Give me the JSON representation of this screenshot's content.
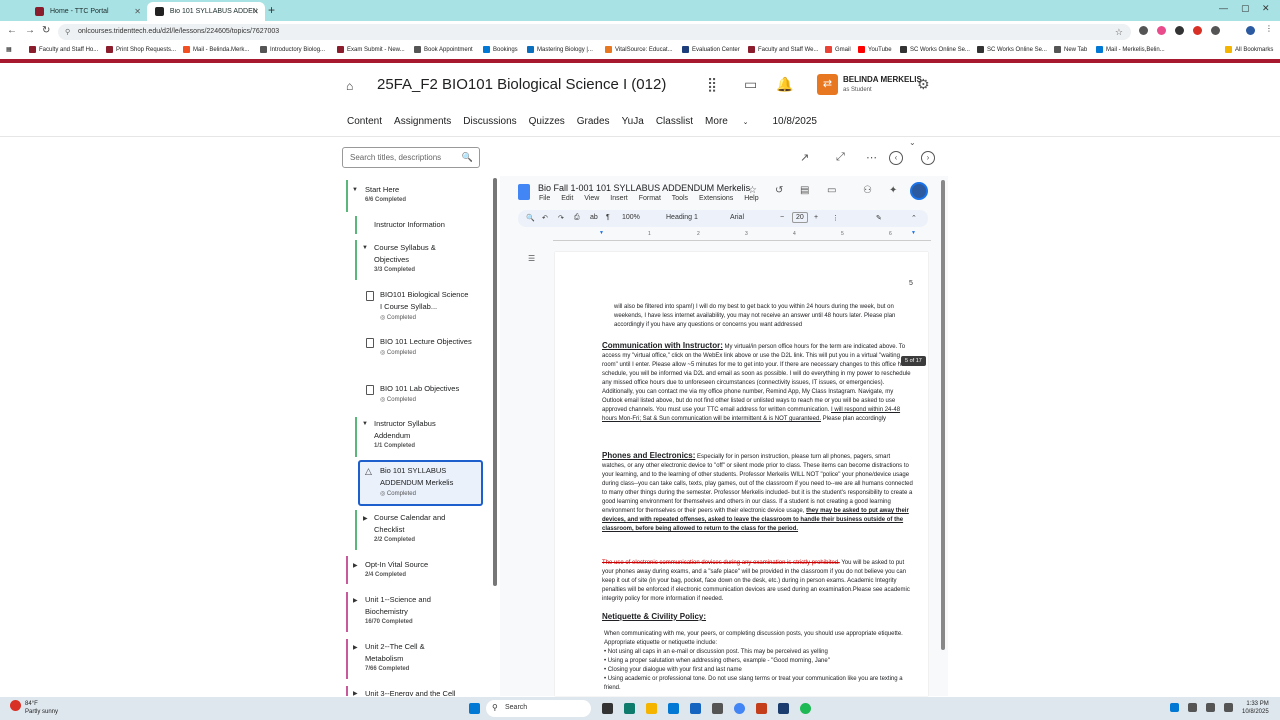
{
  "browser": {
    "tabs": [
      {
        "label": "Home - TTC Portal"
      },
      {
        "label": "Bio 101 SYLLABUS ADDENDUM"
      }
    ],
    "url": "onlcourses.tridenttech.edu/d2l/le/lessons/224605/topics/7627003",
    "bookmarks": [
      "Faculty and Staff Ho...",
      "Print Shop Requests...",
      "Mail - Belinda.Merk...",
      "Introductory Biolog...",
      "Exam Submit - New...",
      "Book Appointment",
      "Bookings",
      "Mastering Biology |...",
      "VitalSource: Educat...",
      "Evaluation Center",
      "Faculty and Staff We...",
      "Gmail",
      "YouTube",
      "SC Works Online Se...",
      "SC Works Online Se...",
      "New Tab",
      "Mail - Merkelis,Belin..."
    ],
    "all_bookmarks": "All Bookmarks"
  },
  "header": {
    "course_title": "25FA_F2 BIO101 Biological Science I (012)",
    "user_name": "BELINDA MERKELIS",
    "user_role": "as Student"
  },
  "nav": [
    "Content",
    "Assignments",
    "Discussions",
    "Quizzes",
    "Grades",
    "YuJa",
    "Classlist",
    "More",
    "10/8/2025"
  ],
  "sidebar": {
    "search_placeholder": "Search titles, descriptions",
    "items": [
      {
        "title": "Start Here",
        "status": "6/6 Completed"
      },
      {
        "title": "Instructor Information",
        "status": ""
      },
      {
        "title": "Course Syllabus & Objectives",
        "status": "3/3 Completed"
      },
      {
        "title": "BIO101 Biological Science I Course Syllab...",
        "status": "Completed"
      },
      {
        "title": "BIO 101 Lecture Objectives",
        "status": "Completed"
      },
      {
        "title": "BIO 101 Lab Objectives",
        "status": "Completed"
      },
      {
        "title": "Instructor Syllabus Addendum",
        "status": "1/1 Completed"
      },
      {
        "title": "Bio 101 SYLLABUS ADDENDUM Merkelis",
        "status": "Completed"
      },
      {
        "title": "Course Calendar and Checklist",
        "status": "2/2 Completed"
      },
      {
        "title": "Opt-In Vital Source",
        "status": "2/4 Completed"
      },
      {
        "title": "Unit 1--Science and Biochemistry",
        "status": "16/70 Completed"
      },
      {
        "title": "Unit 2--The Cell & Metabolism",
        "status": "7/66 Completed"
      },
      {
        "title": "Unit 3--Energy and the Cell",
        "status": ""
      }
    ]
  },
  "doc": {
    "title": "Bio Fall 1-001 101 SYLLABUS ADDENDUM Merkelis",
    "menu": [
      "File",
      "Edit",
      "View",
      "Insert",
      "Format",
      "Tools",
      "Extensions",
      "Help"
    ],
    "zoom": "100%",
    "style": "Heading 1",
    "font": "Arial",
    "font_size": "20",
    "page_number": "5",
    "page_indicator": "5 of 17",
    "p0": "will also be filtered into spam!) I will do my best to get back to you within 24 hours during the week, but on weekends, I have less internet availability, you may not receive an answer until 48 hours later. Please plan accordingly if you have any questions or concerns you want addressed",
    "h1": "Communication with Instructor:",
    "p1a": " My virtual/in person office hours for the term are indicated above. To access my \"virtual office,\" click on the WebEx link above or use the D2L link. This will put you in a virtual \"waiting room\" until I enter. Please allow ~5 minutes for me to get into your. If there are necessary changes to this office hour schedule, you will be informed via D2L and email as soon as possible. I will do everything in my power to reschedule any missed office hours due to unforeseen circumstances (connectivity issues, IT issues, or emergencies). Additionally, you can contact me via my office phone number, Remind App, My Class Instagram. Navigate, my Outlook email listed above, but do not find other listed or unlisted ways to reach me or you will be asked to use approved channels. You must use your TTC email address for written communication.",
    "p1u": "I will respond within 24-48 hours Mon-Fri; Sat & Sun communication will be intermittent & is NOT guaranteed.",
    "p1b": " Please plan accordingly",
    "h2": "Phones and Electronics:",
    "p2a": " Especially for in person instruction, please turn all phones, pagers, smart watches, or any other electronic device to \"off\" or silent mode prior to class. These items can become distractions to your learning, and to the learning of other students. Professor Merkelis WILL NOT \"police\" your phone/device usage during class--you can take calls, texts, play games, out of the classroom if you need to--we are all humans connected to many other things during the semester. Professor Merkelis included- but it is the student's responsibility to create a good learning environment for themselves and others in our class. If a student is not creating a good learning environment for themselves or their peers with their electronic device usage,",
    "p2u": "they may be asked to put away their devices, and with repeated offenses, asked to leave the classroom to handle their business outside of the classroom, before being allowed to return to the class for the period.",
    "p3r": "The use of electronic communication devices during any examination is strictly prohibited.",
    "p3": " You will be asked to put your phones away during exams, and a \"safe place\" will be provided in the classroom if you do not believe you can keep it out of site (in your bag, pocket, face down on the desk, etc.) during in person exams. Academic Integrity penalties will be enforced if electronic communication devices are used during an examination.Please see academic integrity policy for more information if needed.",
    "h3": "Netiquette & Civility Policy:",
    "p4": "When communicating with me, your peers, or completing discussion posts, you should use appropriate etiquette. Appropriate etiquette or netiquette include:",
    "bullets": [
      "Not using all caps in an e-mail or discussion post. This may be perceived as yelling",
      "Using a proper salutation when addressing others, example - \"Good morning, Jane\"",
      "Closing your dialogue with your first and last name",
      "Using academic or professional tone. Do not use slang terms or treat your communication like you are texting a friend."
    ]
  },
  "taskbar": {
    "temp": "84°F",
    "weather": "Partly sunny",
    "search": "Search",
    "time": "1:33 PM",
    "date": "10/8/2025"
  },
  "colors": {
    "brand": "#a6192e",
    "accent": "#1d5fcc",
    "complete": "#5ab77a"
  }
}
